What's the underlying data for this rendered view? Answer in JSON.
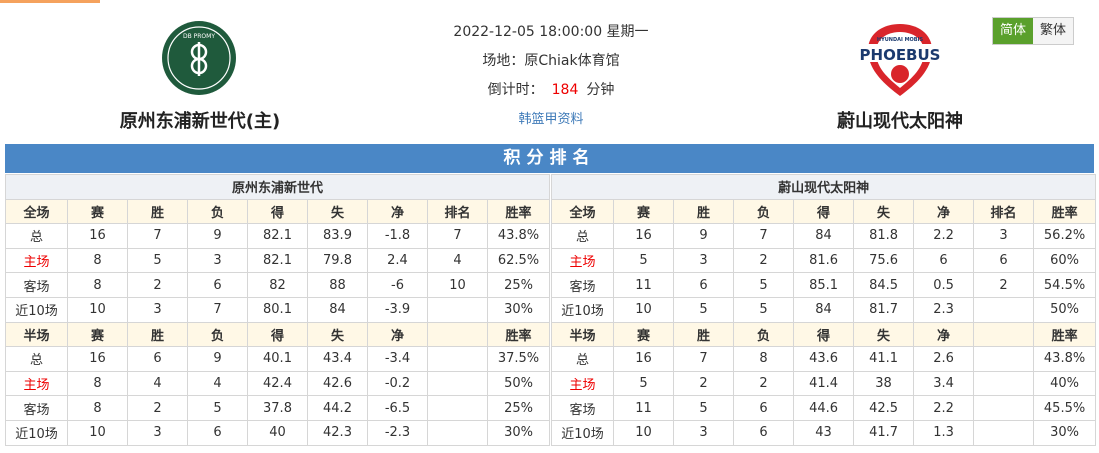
{
  "header": {
    "datetime": "2022-12-05 18:00:00 星期一",
    "venue": "场地：原Chiak体育馆",
    "countdown_label": "倒计时：",
    "countdown_value": "184",
    "countdown_unit": "分钟",
    "league_link": "韩篮甲资料",
    "home_team": "原州东浦新世代(主)",
    "away_team": "蔚山现代太阳神",
    "home_logo_text": "DB PROMY",
    "away_logo_text": "PHOEBUS",
    "away_logo_subtext": "HYUNDAI MOBIS"
  },
  "lang": {
    "simplified": "简体",
    "traditional": "繁体"
  },
  "title": "积分排名",
  "colors": {
    "title_bar": "#4a87c6",
    "active_lang": "#5aa02c",
    "highlight": "#e00000"
  },
  "home_table": {
    "team": "原州东浦新世代",
    "full_header": [
      "全场",
      "赛",
      "胜",
      "负",
      "得",
      "失",
      "净",
      "排名",
      "胜率"
    ],
    "full_rows": [
      [
        "总",
        "16",
        "7",
        "9",
        "82.1",
        "83.9",
        "-1.8",
        "7",
        "43.8%"
      ],
      [
        "主场",
        "8",
        "5",
        "3",
        "82.1",
        "79.8",
        "2.4",
        "4",
        "62.5%"
      ],
      [
        "客场",
        "8",
        "2",
        "6",
        "82",
        "88",
        "-6",
        "10",
        "25%"
      ],
      [
        "近10场",
        "10",
        "3",
        "7",
        "80.1",
        "84",
        "-3.9",
        "",
        "30%"
      ]
    ],
    "half_header": [
      "半场",
      "赛",
      "胜",
      "负",
      "得",
      "失",
      "净",
      "",
      "胜率"
    ],
    "half_rows": [
      [
        "总",
        "16",
        "6",
        "9",
        "40.1",
        "43.4",
        "-3.4",
        "",
        "37.5%"
      ],
      [
        "主场",
        "8",
        "4",
        "4",
        "42.4",
        "42.6",
        "-0.2",
        "",
        "50%"
      ],
      [
        "客场",
        "8",
        "2",
        "5",
        "37.8",
        "44.2",
        "-6.5",
        "",
        "25%"
      ],
      [
        "近10场",
        "10",
        "3",
        "6",
        "40",
        "42.3",
        "-2.3",
        "",
        "30%"
      ]
    ]
  },
  "away_table": {
    "team": "蔚山现代太阳神",
    "full_header": [
      "全场",
      "赛",
      "胜",
      "负",
      "得",
      "失",
      "净",
      "排名",
      "胜率"
    ],
    "full_rows": [
      [
        "总",
        "16",
        "9",
        "7",
        "84",
        "81.8",
        "2.2",
        "3",
        "56.2%"
      ],
      [
        "主场",
        "5",
        "3",
        "2",
        "81.6",
        "75.6",
        "6",
        "6",
        "60%"
      ],
      [
        "客场",
        "11",
        "6",
        "5",
        "85.1",
        "84.5",
        "0.5",
        "2",
        "54.5%"
      ],
      [
        "近10场",
        "10",
        "5",
        "5",
        "84",
        "81.7",
        "2.3",
        "",
        "50%"
      ]
    ],
    "half_header": [
      "半场",
      "赛",
      "胜",
      "负",
      "得",
      "失",
      "净",
      "",
      "胜率"
    ],
    "half_rows": [
      [
        "总",
        "16",
        "7",
        "8",
        "43.6",
        "41.1",
        "2.6",
        "",
        "43.8%"
      ],
      [
        "主场",
        "5",
        "2",
        "2",
        "41.4",
        "38",
        "3.4",
        "",
        "40%"
      ],
      [
        "客场",
        "11",
        "5",
        "6",
        "44.6",
        "42.5",
        "2.2",
        "",
        "45.5%"
      ],
      [
        "近10场",
        "10",
        "3",
        "6",
        "43",
        "41.7",
        "1.3",
        "",
        "30%"
      ]
    ]
  }
}
